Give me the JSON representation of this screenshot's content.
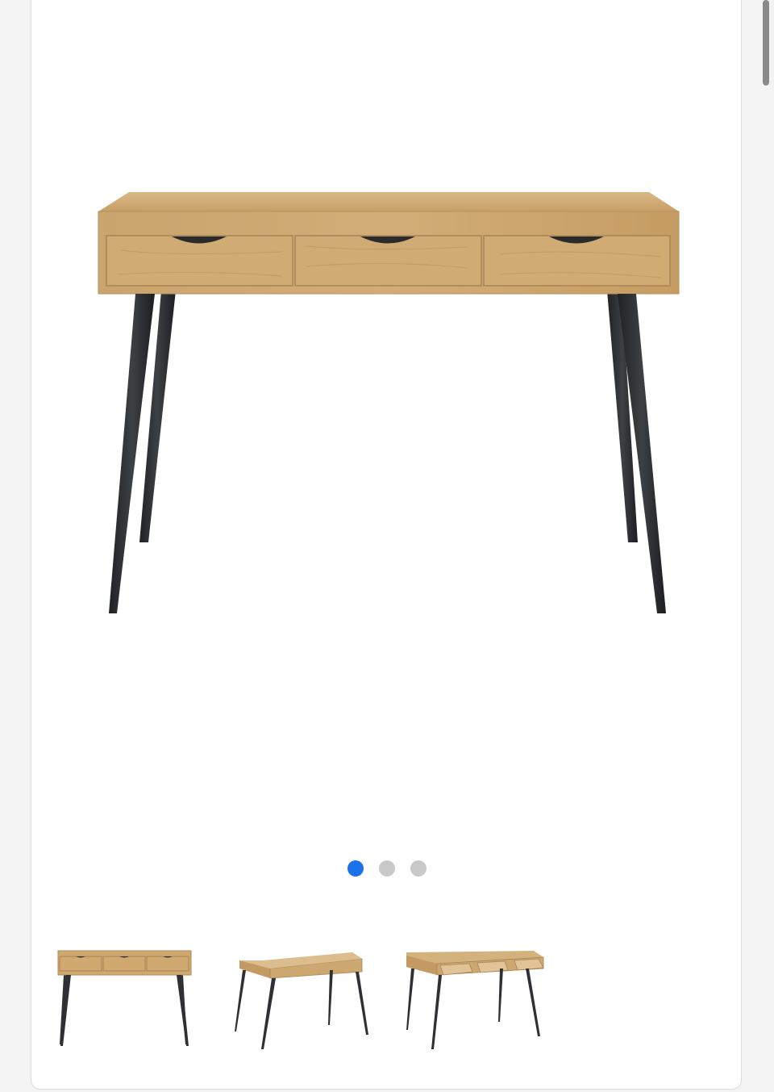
{
  "product_gallery": {
    "main_image": "wooden-desk-front-view",
    "thumbnails": [
      {
        "name": "desk-front-view-thumbnail"
      },
      {
        "name": "desk-angled-view-thumbnail"
      },
      {
        "name": "desk-drawers-open-thumbnail"
      }
    ],
    "slides_total": 3,
    "active_slide": 1
  },
  "colors": {
    "active_dot": "#1a73e8",
    "inactive_dot": "#c9c9c9",
    "wood": "#c9a36b",
    "legs": "#2e3033"
  }
}
